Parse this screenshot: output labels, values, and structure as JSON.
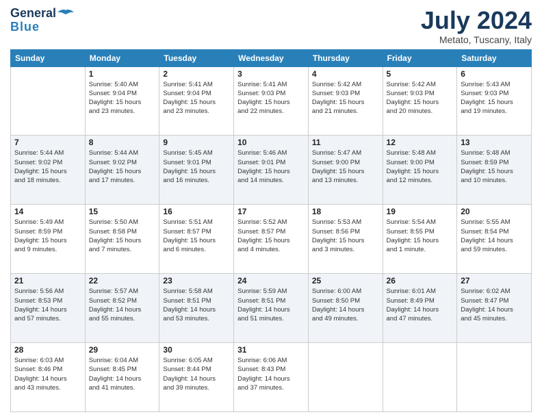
{
  "header": {
    "logo_general": "General",
    "logo_blue": "Blue",
    "month": "July 2024",
    "location": "Metato, Tuscany, Italy"
  },
  "columns": [
    "Sunday",
    "Monday",
    "Tuesday",
    "Wednesday",
    "Thursday",
    "Friday",
    "Saturday"
  ],
  "weeks": [
    [
      {
        "day": "",
        "info": ""
      },
      {
        "day": "1",
        "info": "Sunrise: 5:40 AM\nSunset: 9:04 PM\nDaylight: 15 hours\nand 23 minutes."
      },
      {
        "day": "2",
        "info": "Sunrise: 5:41 AM\nSunset: 9:04 PM\nDaylight: 15 hours\nand 23 minutes."
      },
      {
        "day": "3",
        "info": "Sunrise: 5:41 AM\nSunset: 9:03 PM\nDaylight: 15 hours\nand 22 minutes."
      },
      {
        "day": "4",
        "info": "Sunrise: 5:42 AM\nSunset: 9:03 PM\nDaylight: 15 hours\nand 21 minutes."
      },
      {
        "day": "5",
        "info": "Sunrise: 5:42 AM\nSunset: 9:03 PM\nDaylight: 15 hours\nand 20 minutes."
      },
      {
        "day": "6",
        "info": "Sunrise: 5:43 AM\nSunset: 9:03 PM\nDaylight: 15 hours\nand 19 minutes."
      }
    ],
    [
      {
        "day": "7",
        "info": "Sunrise: 5:44 AM\nSunset: 9:02 PM\nDaylight: 15 hours\nand 18 minutes."
      },
      {
        "day": "8",
        "info": "Sunrise: 5:44 AM\nSunset: 9:02 PM\nDaylight: 15 hours\nand 17 minutes."
      },
      {
        "day": "9",
        "info": "Sunrise: 5:45 AM\nSunset: 9:01 PM\nDaylight: 15 hours\nand 16 minutes."
      },
      {
        "day": "10",
        "info": "Sunrise: 5:46 AM\nSunset: 9:01 PM\nDaylight: 15 hours\nand 14 minutes."
      },
      {
        "day": "11",
        "info": "Sunrise: 5:47 AM\nSunset: 9:00 PM\nDaylight: 15 hours\nand 13 minutes."
      },
      {
        "day": "12",
        "info": "Sunrise: 5:48 AM\nSunset: 9:00 PM\nDaylight: 15 hours\nand 12 minutes."
      },
      {
        "day": "13",
        "info": "Sunrise: 5:48 AM\nSunset: 8:59 PM\nDaylight: 15 hours\nand 10 minutes."
      }
    ],
    [
      {
        "day": "14",
        "info": "Sunrise: 5:49 AM\nSunset: 8:59 PM\nDaylight: 15 hours\nand 9 minutes."
      },
      {
        "day": "15",
        "info": "Sunrise: 5:50 AM\nSunset: 8:58 PM\nDaylight: 15 hours\nand 7 minutes."
      },
      {
        "day": "16",
        "info": "Sunrise: 5:51 AM\nSunset: 8:57 PM\nDaylight: 15 hours\nand 6 minutes."
      },
      {
        "day": "17",
        "info": "Sunrise: 5:52 AM\nSunset: 8:57 PM\nDaylight: 15 hours\nand 4 minutes."
      },
      {
        "day": "18",
        "info": "Sunrise: 5:53 AM\nSunset: 8:56 PM\nDaylight: 15 hours\nand 3 minutes."
      },
      {
        "day": "19",
        "info": "Sunrise: 5:54 AM\nSunset: 8:55 PM\nDaylight: 15 hours\nand 1 minute."
      },
      {
        "day": "20",
        "info": "Sunrise: 5:55 AM\nSunset: 8:54 PM\nDaylight: 14 hours\nand 59 minutes."
      }
    ],
    [
      {
        "day": "21",
        "info": "Sunrise: 5:56 AM\nSunset: 8:53 PM\nDaylight: 14 hours\nand 57 minutes."
      },
      {
        "day": "22",
        "info": "Sunrise: 5:57 AM\nSunset: 8:52 PM\nDaylight: 14 hours\nand 55 minutes."
      },
      {
        "day": "23",
        "info": "Sunrise: 5:58 AM\nSunset: 8:51 PM\nDaylight: 14 hours\nand 53 minutes."
      },
      {
        "day": "24",
        "info": "Sunrise: 5:59 AM\nSunset: 8:51 PM\nDaylight: 14 hours\nand 51 minutes."
      },
      {
        "day": "25",
        "info": "Sunrise: 6:00 AM\nSunset: 8:50 PM\nDaylight: 14 hours\nand 49 minutes."
      },
      {
        "day": "26",
        "info": "Sunrise: 6:01 AM\nSunset: 8:49 PM\nDaylight: 14 hours\nand 47 minutes."
      },
      {
        "day": "27",
        "info": "Sunrise: 6:02 AM\nSunset: 8:47 PM\nDaylight: 14 hours\nand 45 minutes."
      }
    ],
    [
      {
        "day": "28",
        "info": "Sunrise: 6:03 AM\nSunset: 8:46 PM\nDaylight: 14 hours\nand 43 minutes."
      },
      {
        "day": "29",
        "info": "Sunrise: 6:04 AM\nSunset: 8:45 PM\nDaylight: 14 hours\nand 41 minutes."
      },
      {
        "day": "30",
        "info": "Sunrise: 6:05 AM\nSunset: 8:44 PM\nDaylight: 14 hours\nand 39 minutes."
      },
      {
        "day": "31",
        "info": "Sunrise: 6:06 AM\nSunset: 8:43 PM\nDaylight: 14 hours\nand 37 minutes."
      },
      {
        "day": "",
        "info": ""
      },
      {
        "day": "",
        "info": ""
      },
      {
        "day": "",
        "info": ""
      }
    ]
  ]
}
